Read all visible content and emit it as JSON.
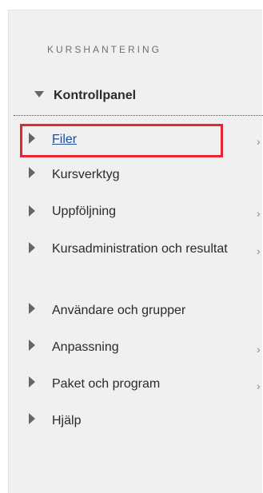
{
  "section": {
    "title": "KURSHANTERING"
  },
  "control_panel": {
    "label": "Kontrollpanel"
  },
  "items": [
    {
      "label": "Filer",
      "link": true,
      "has_submenu": true
    },
    {
      "label": "Kursverktyg",
      "link": false,
      "has_submenu": false
    },
    {
      "label": "Uppföljning",
      "link": false,
      "has_submenu": true
    },
    {
      "label": "Kursadministration och resultat",
      "link": false,
      "has_submenu": true
    },
    {
      "label": "Användare och grupper",
      "link": false,
      "has_submenu": false
    },
    {
      "label": "Anpassning",
      "link": false,
      "has_submenu": true
    },
    {
      "label": "Paket och program",
      "link": false,
      "has_submenu": true
    },
    {
      "label": "Hjälp",
      "link": false,
      "has_submenu": false
    }
  ],
  "chevron_glyph": "›",
  "colors": {
    "panel_bg": "#f0f0f0",
    "highlight": "#e8242e",
    "link": "#1d4d9c",
    "text": "#2a2a2a",
    "arrow": "#666666"
  }
}
